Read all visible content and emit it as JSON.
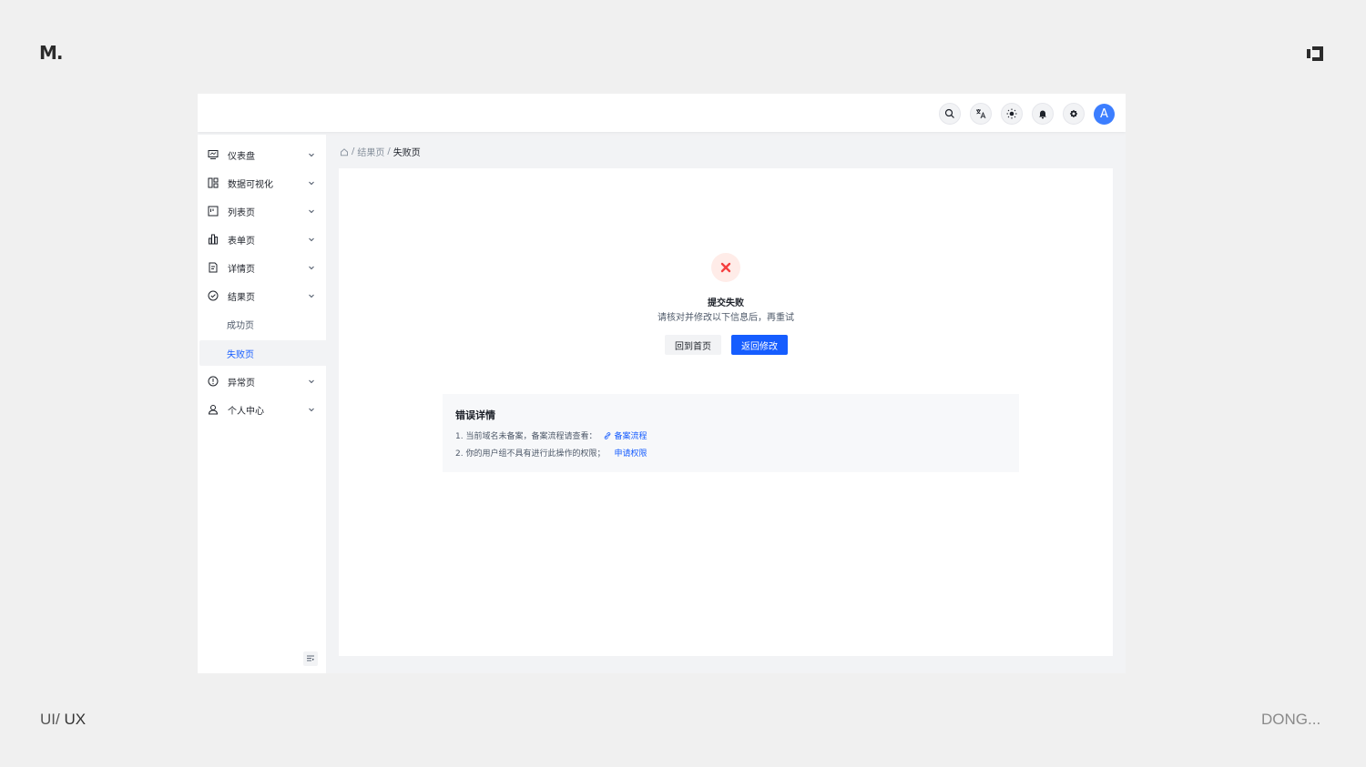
{
  "brand": {
    "logo": "M."
  },
  "footer": {
    "left_prefix": "UI/",
    "left_main": "UX",
    "right": "DONG..."
  },
  "topbar": {
    "icons": [
      "search-icon",
      "translate-icon",
      "sun-icon",
      "bell-icon",
      "settings-icon"
    ],
    "avatar_letter": "A"
  },
  "sidebar": {
    "items": [
      {
        "label": "仪表盘",
        "icon": "dashboard-icon"
      },
      {
        "label": "数据可视化",
        "icon": "visualization-icon"
      },
      {
        "label": "列表页",
        "icon": "list-icon"
      },
      {
        "label": "表单页",
        "icon": "form-icon"
      },
      {
        "label": "详情页",
        "icon": "detail-icon"
      },
      {
        "label": "结果页",
        "icon": "result-icon"
      },
      {
        "label": "成功页"
      },
      {
        "label": "失败页"
      },
      {
        "label": "异常页",
        "icon": "exception-icon"
      },
      {
        "label": "个人中心",
        "icon": "user-icon"
      }
    ]
  },
  "breadcrumb": {
    "sep": "/",
    "parent": "结果页",
    "current": "失败页"
  },
  "result": {
    "title": "提交失败",
    "subtitle": "请核对并修改以下信息后，再重试",
    "back_home": "回到首页",
    "back_edit": "返回修改"
  },
  "errors": {
    "title": "错误详情",
    "line1_text": "1. 当前域名未备案，备案流程请查看：",
    "line1_link": "备案流程",
    "line2_text": "2. 你的用户组不具有进行此操作的权限；",
    "line2_link": "申请权限"
  },
  "colors": {
    "primary": "#165dff",
    "danger": "#f53f3f",
    "avatar": "#3c7eff"
  }
}
